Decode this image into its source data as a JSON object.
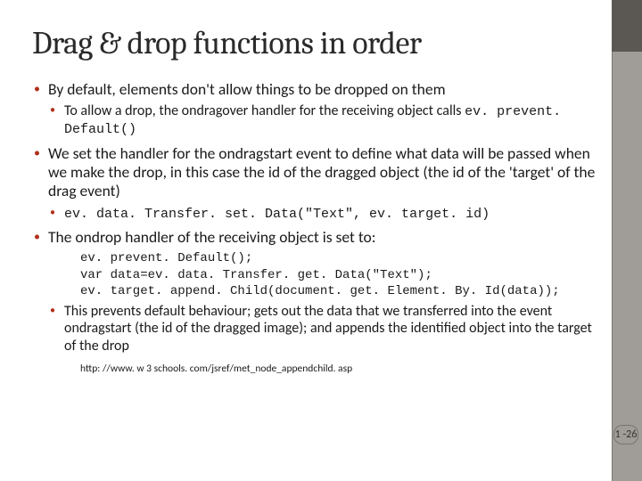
{
  "title": "Drag & drop functions in order",
  "b1": {
    "text": "By default, elements don't allow things to be dropped on them",
    "sub1_a": "To allow a drop, the ondragover handler for the receiving object calls ",
    "sub1_code": "ev. prevent. Default()"
  },
  "b2": {
    "text": "We set the handler for the ondragstart event to define what data will be passed when we make the drop, in this case the id of the dragged object (the id of the 'target' of the drag event)",
    "sub1_code": "ev. data. Transfer. set. Data(\"Text\", ev. target. id)"
  },
  "b3": {
    "text": "The ondrop handler of the receiving object is set to:",
    "code": "ev. prevent. Default();\nvar data=ev. data. Transfer. get. Data(\"Text\");\nev. target. append. Child(document. get. Element. By. Id(data));",
    "sub1": "This prevents default behaviour; gets out the data that we transferred into the event ondragstart (the id of the dragged image); and appends the identified object into the target of the drop"
  },
  "footref": "http: //www. w 3 schools. com/jsref/met_node_appendchild. asp",
  "pagenum": "1 -26"
}
